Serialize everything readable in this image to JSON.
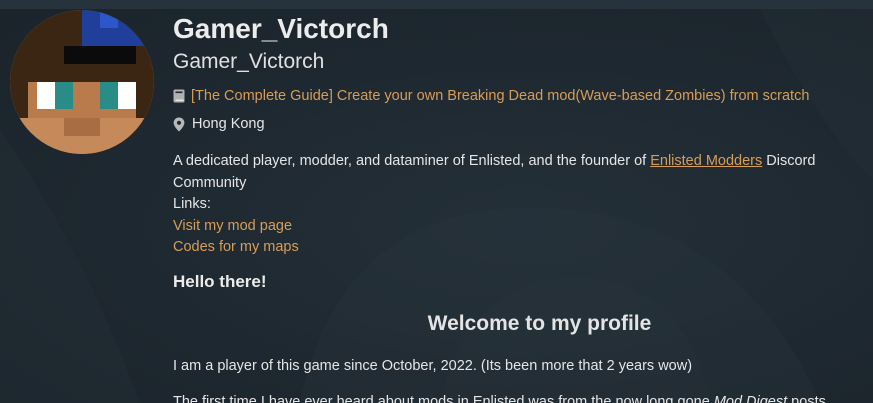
{
  "profile": {
    "username": "Gamer_Victorch",
    "display_name": "Gamer_Victorch",
    "featured_icon": "book-icon",
    "featured_link": "[The Complete Guide] Create your own Breaking Dead mod(Wave-based Zombies) from scratch",
    "location_icon": "map-pin-icon",
    "location": "Hong Kong"
  },
  "bio": {
    "intro_before": "A dedicated player, modder, and dataminer of Enlisted, and the founder of ",
    "community_link": "Enlisted Modders",
    "intro_after": " Discord Community",
    "links_heading": "Links:",
    "links": [
      "Visit my mod page",
      "Codes for my maps"
    ]
  },
  "post": {
    "hello": "Hello there!",
    "welcome": "Welcome to my profile",
    "paragraph1": "I am a player of this game since October, 2022. (Its been more that 2 years wow)",
    "paragraph2_before": "The first time I have ever heard about mods in Enlisted was from the now long gone ",
    "paragraph2_italic": "Mod Digest",
    "paragraph2_after": " posts"
  },
  "colors": {
    "accent": "#d79d58",
    "background": "#1f2a33",
    "text": "#e6e6e6"
  }
}
